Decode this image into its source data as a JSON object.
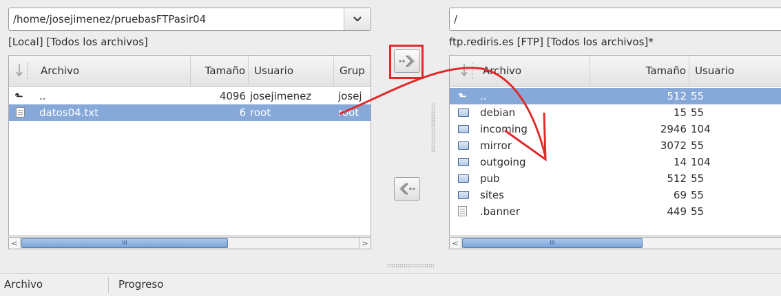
{
  "local": {
    "path": "/home/josejimenez/pruebasFTPasir04",
    "panel_title": "[Local] [Todos los archivos]",
    "columns": [
      "Archivo",
      "Tamaño",
      "Usuario",
      "Grup"
    ],
    "rows": [
      {
        "name": "..",
        "icon": "parent-dir-icon",
        "size": "4096",
        "user": "josejimenez",
        "group": "josej",
        "selected": false
      },
      {
        "name": "datos04.txt",
        "icon": "text-file-icon",
        "size": "6",
        "user": "root",
        "group": "root",
        "selected": true
      }
    ],
    "scroll_thumb": "III"
  },
  "remote": {
    "path": "/",
    "panel_title": "ftp.rediris.es [FTP] [Todos los archivos]*",
    "columns": [
      "Archivo",
      "Tamaño",
      "Usuario"
    ],
    "rows": [
      {
        "name": "..",
        "icon": "parent-dir-icon",
        "size": "512",
        "user": "55",
        "selected": true
      },
      {
        "name": "debian",
        "icon": "folder-icon",
        "size": "15",
        "user": "55",
        "selected": false
      },
      {
        "name": "incoming",
        "icon": "folder-icon",
        "size": "2946",
        "user": "104",
        "selected": false
      },
      {
        "name": "mirror",
        "icon": "folder-icon",
        "size": "3072",
        "user": "55",
        "selected": false
      },
      {
        "name": "outgoing",
        "icon": "folder-icon",
        "size": "14",
        "user": "104",
        "selected": false
      },
      {
        "name": "pub",
        "icon": "folder-icon",
        "size": "512",
        "user": "55",
        "selected": false
      },
      {
        "name": "sites",
        "icon": "folder-icon",
        "size": "69",
        "user": "55",
        "selected": false
      },
      {
        "name": ".banner",
        "icon": "text-file-icon",
        "size": "449",
        "user": "55",
        "selected": false
      }
    ],
    "scroll_thumb": "III"
  },
  "transfer": {
    "upload_icon": "upload-arrow-icon",
    "download_icon": "download-arrow-icon",
    "highlight_color": "#e02a2a"
  },
  "status_bar": {
    "col1": "Archivo",
    "col2": "Progreso"
  },
  "colors": {
    "selection": "#86a9d9",
    "annotation_arrow": "#e02a2a"
  }
}
